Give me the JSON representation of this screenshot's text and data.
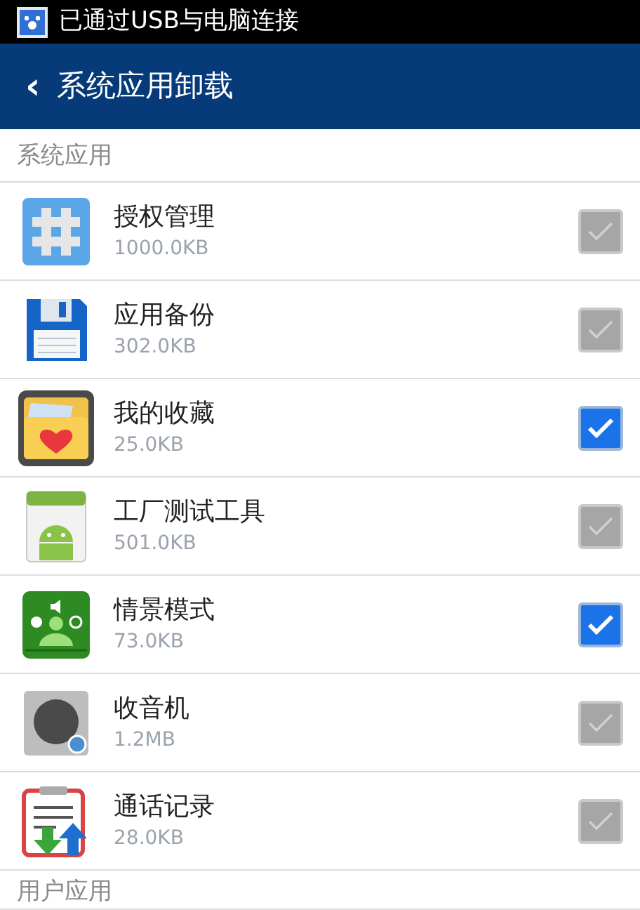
{
  "status_bar": {
    "notification": "已通过USB与电脑连接"
  },
  "header": {
    "back": "‹",
    "title": "系统应用卸载"
  },
  "sections": [
    {
      "title": "系统应用",
      "apps": [
        {
          "kind": "hash",
          "name": "授权管理",
          "size": "1000.0KB",
          "checked": false
        },
        {
          "kind": "floppy",
          "name": "应用备份",
          "size": "302.0KB",
          "checked": false
        },
        {
          "kind": "folder",
          "name": "我的收藏",
          "size": "25.0KB",
          "checked": true
        },
        {
          "kind": "android",
          "name": "工厂测试工具",
          "size": "501.0KB",
          "checked": false
        },
        {
          "kind": "profile",
          "name": "情景模式",
          "size": "73.0KB",
          "checked": true
        },
        {
          "kind": "radio",
          "name": "收音机",
          "size": "1.2MB",
          "checked": false
        },
        {
          "kind": "clipboard",
          "name": "通话记录",
          "size": "28.0KB",
          "checked": false
        }
      ]
    },
    {
      "title": "用户应用"
    }
  ]
}
